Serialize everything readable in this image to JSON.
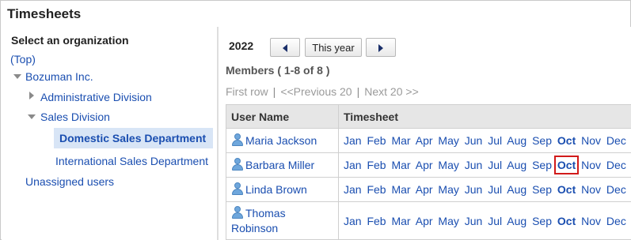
{
  "window": {
    "title": "Timesheets"
  },
  "org_tree": {
    "heading": "Select an organization",
    "top_label": "(Top)",
    "root": "Bozuman Inc.",
    "admin_division": "Administrative Division",
    "sales_division": "Sales Division",
    "domestic_sales": "Domestic Sales Department",
    "international_sales": "International Sales Department",
    "unassigned": "Unassigned users"
  },
  "year_nav": {
    "year": "2022",
    "this_year_label": "This year",
    "prev_icon": "triangle-left-icon",
    "next_icon": "triangle-right-icon"
  },
  "members": {
    "summary": "Members ( 1-8 of 8 )",
    "pager": {
      "first": "First row",
      "prev": "<<Previous 20",
      "next": "Next 20 >>",
      "separator": "|"
    }
  },
  "table": {
    "headers": {
      "user": "User Name",
      "timesheet": "Timesheet"
    },
    "months": [
      "Jan",
      "Feb",
      "Mar",
      "Apr",
      "May",
      "Jun",
      "Jul",
      "Aug",
      "Sep",
      "Oct",
      "Nov",
      "Dec"
    ],
    "current_month": "Oct",
    "highlighted_row": 1,
    "rows": [
      {
        "name": "Maria Jackson"
      },
      {
        "name": "Barbara Miller"
      },
      {
        "name": "Linda Brown"
      },
      {
        "name": "Thomas Robinson"
      }
    ]
  },
  "colors": {
    "link": "#1a4eb0",
    "selected_bg": "#d8e5f6",
    "header_bg": "#e6e6e6",
    "highlight_box": "#d11a1a"
  }
}
